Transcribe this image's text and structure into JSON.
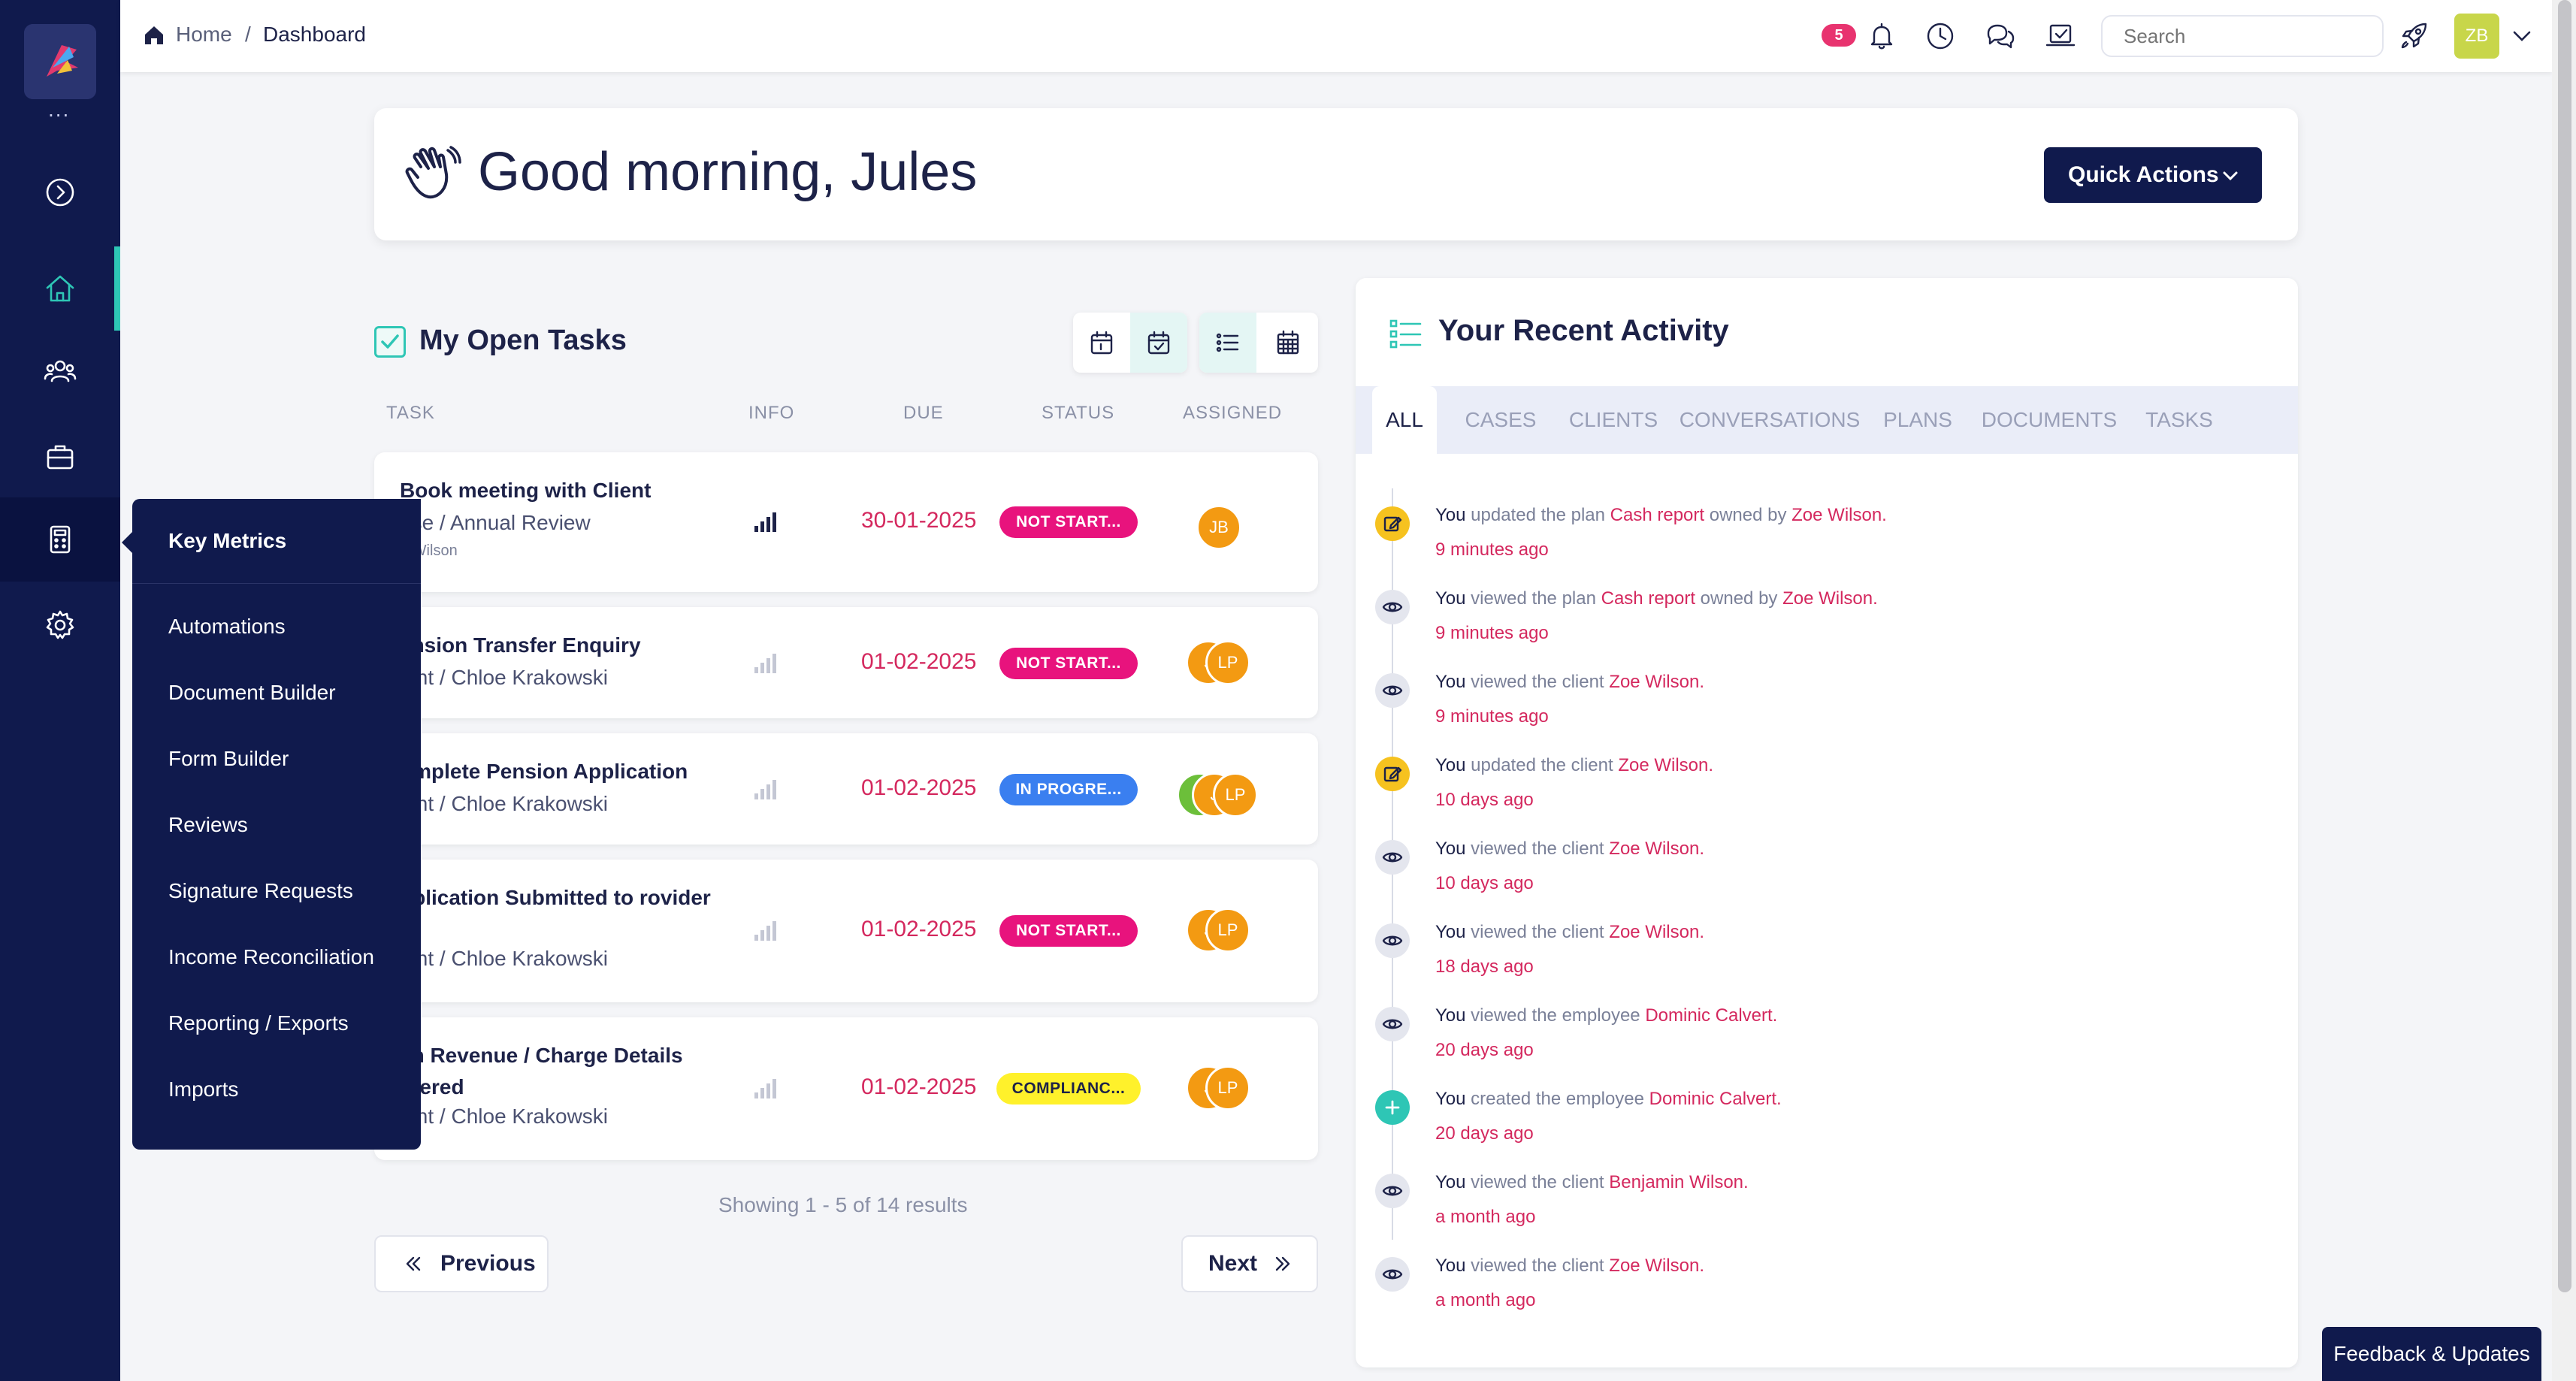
{
  "breadcrumb": {
    "home": "Home",
    "separator": "/",
    "current": "Dashboard"
  },
  "topbar": {
    "notification_count": "5",
    "search_placeholder": "Search",
    "user_initials": "ZB",
    "icons": [
      "bell-icon",
      "clock-icon",
      "chat-icon",
      "laptop-check-icon",
      "rocket-icon",
      "chevron-down-icon"
    ]
  },
  "sidebar": {
    "logo_dots": "...",
    "items": [
      "expand-icon",
      "home-icon",
      "users-icon",
      "briefcase-icon",
      "calculator-icon",
      "gear-icon"
    ]
  },
  "flyout": {
    "title": "Key Metrics",
    "items": [
      "Automations",
      "Document Builder",
      "Form Builder",
      "Reviews",
      "Signature Requests",
      "Income Reconciliation",
      "Reporting / Exports",
      "Imports"
    ]
  },
  "greeting": {
    "text": "Good morning, Jules",
    "quick_actions": "Quick Actions"
  },
  "tasks": {
    "title": "My Open Tasks",
    "columns": {
      "task": "TASK",
      "info": "INFO",
      "due": "DUE",
      "status": "STATUS",
      "assigned": "ASSIGNED"
    },
    "rows": [
      {
        "name": "Book meeting with Client",
        "sub": "ase  / Annual Review",
        "sub2": "e Wilson",
        "due": "30-01-2025",
        "status": "NOT START...",
        "assignees": [
          "JB"
        ]
      },
      {
        "name": "ension Transfer Enquiry",
        "sub": "ient  / Chloe Krakowski",
        "due": "01-02-2025",
        "status": "NOT START...",
        "assignees": [
          "J",
          "LP"
        ]
      },
      {
        "name": "omplete Pension Application",
        "sub": "ient  / Chloe Krakowski",
        "due": "01-02-2025",
        "status": "IN PROGRE...",
        "assignees": [
          "A",
          "J",
          "LP"
        ]
      },
      {
        "name": "pplication Submitted to rovider",
        "sub": "ient  / Chloe Krakowski",
        "due": "01-02-2025",
        "status": "NOT START...",
        "assignees": [
          "J",
          "LP"
        ]
      },
      {
        "name": "an Revenue / Charge Details ntered",
        "sub": "ient  / Chloe Krakowski",
        "due": "01-02-2025",
        "status": "COMPLIANC...",
        "assignees": [
          "J",
          "LP"
        ]
      }
    ],
    "showing": "Showing 1 - 5 of 14 results",
    "previous": "Previous",
    "next": "Next"
  },
  "activity": {
    "title": "Your Recent Activity",
    "tabs": [
      "ALL",
      "CASES",
      "CLIENTS",
      "CONVERSATIONS",
      "PLANS",
      "DOCUMENTS",
      "TASKS"
    ],
    "items": [
      {
        "you": "You",
        "action": " updated the plan ",
        "link1": "Cash report",
        "mid": " owned by ",
        "link2": "Zoe Wilson.",
        "time": "9 minutes ago",
        "kind": "edit"
      },
      {
        "you": "You",
        "action": " viewed the plan ",
        "link1": "Cash report",
        "mid": " owned by ",
        "link2": "Zoe Wilson.",
        "time": "9 minutes ago",
        "kind": "view"
      },
      {
        "you": "You",
        "action": " viewed the client ",
        "link1": "Zoe Wilson.",
        "mid": "",
        "link2": "",
        "time": "9 minutes ago",
        "kind": "view"
      },
      {
        "you": "You",
        "action": " updated the client ",
        "link1": "Zoe Wilson.",
        "mid": "",
        "link2": "",
        "time": "10 days ago",
        "kind": "edit"
      },
      {
        "you": "You",
        "action": " viewed the client ",
        "link1": "Zoe Wilson.",
        "mid": "",
        "link2": "",
        "time": "10 days ago",
        "kind": "view"
      },
      {
        "you": "You",
        "action": " viewed the client ",
        "link1": "Zoe Wilson.",
        "mid": "",
        "link2": "",
        "time": "18 days ago",
        "kind": "view"
      },
      {
        "you": "You",
        "action": " viewed the employee ",
        "link1": "Dominic Calvert.",
        "mid": "",
        "link2": "",
        "time": "20 days ago",
        "kind": "view"
      },
      {
        "you": "You",
        "action": " created the employee ",
        "link1": "Dominic Calvert.",
        "mid": "",
        "link2": "",
        "time": "20 days ago",
        "kind": "create"
      },
      {
        "you": "You",
        "action": " viewed the client ",
        "link1": "Benjamin Wilson.",
        "mid": "",
        "link2": "",
        "time": "a month ago",
        "kind": "view"
      },
      {
        "you": "You",
        "action": " viewed the client ",
        "link1": "Zoe Wilson.",
        "mid": "",
        "link2": "",
        "time": "a month ago",
        "kind": "view"
      }
    ]
  },
  "feedback": "Feedback & Updates",
  "colors": {
    "navy": "#101a4d",
    "teal": "#2ec6b5",
    "pink": "#e8137d",
    "blue": "#3a7ff0",
    "yellow": "#fff12b",
    "orange": "#f39a12",
    "green": "#6cbf3a"
  }
}
